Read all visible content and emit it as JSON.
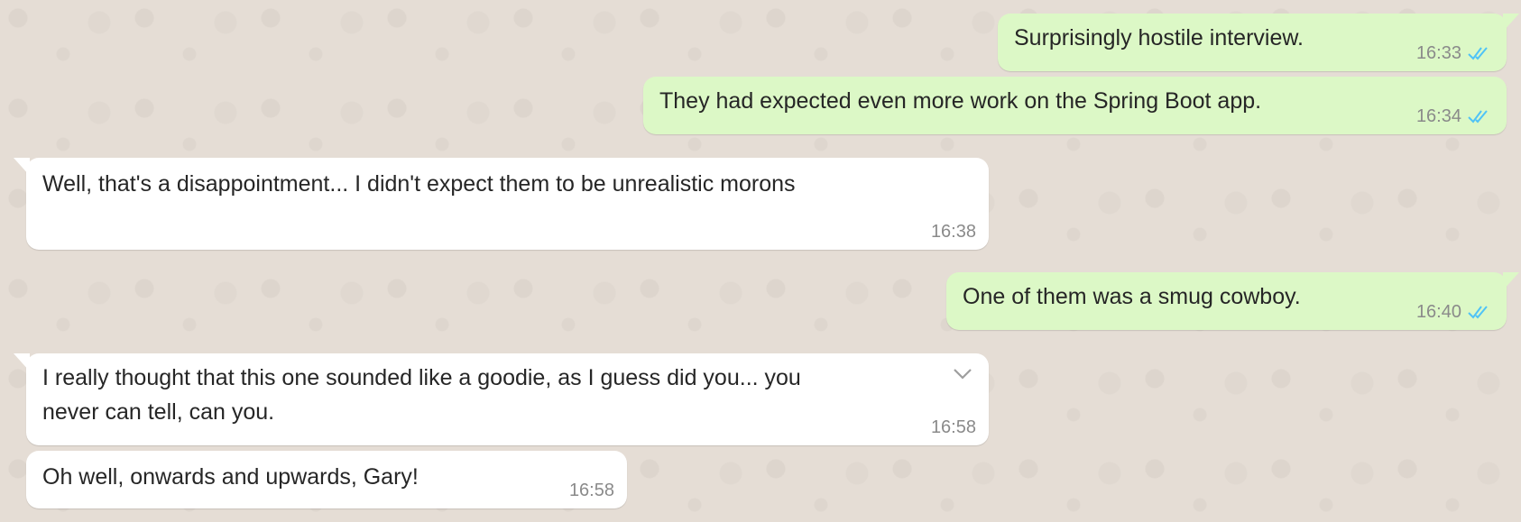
{
  "conversation": {
    "messages": [
      {
        "direction": "outgoing",
        "text": "Surprisingly hostile interview.",
        "time": "16:33",
        "status": "read"
      },
      {
        "direction": "outgoing",
        "text": "They had expected even more work on the Spring Boot app.",
        "time": "16:34",
        "status": "read"
      },
      {
        "direction": "incoming",
        "text": "Well, that's a disappointment... I didn't expect them to be unrealistic morons",
        "time": "16:38"
      },
      {
        "direction": "outgoing",
        "text": "One of them was a smug cowboy.",
        "time": "16:40",
        "status": "read"
      },
      {
        "direction": "incoming",
        "text_line1": "I really thought that this one sounded like a goodie, as I guess did you... you",
        "text_line2": "never can tell, can you.",
        "time": "16:58",
        "menu_icon": "chevron-down-icon"
      },
      {
        "direction": "incoming",
        "text": "Oh well, onwards and upwards, Gary!",
        "time": "16:58"
      }
    ]
  },
  "colors": {
    "background": "#e5ddd5",
    "outgoing_bubble": "#dcf8c6",
    "incoming_bubble": "#ffffff",
    "read_ticks": "#4fc3f7",
    "timestamp": "#8a8a8a"
  },
  "icons": {
    "read_receipt": "double-check-icon",
    "message_menu": "chevron-down-icon"
  }
}
